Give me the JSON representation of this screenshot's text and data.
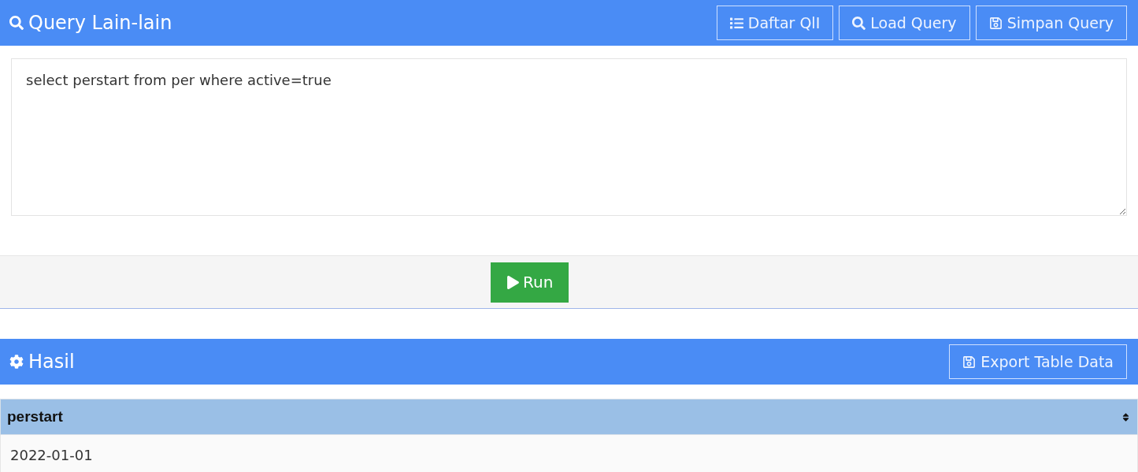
{
  "query_panel": {
    "title": "Query Lain-lain",
    "buttons": [
      {
        "kind": "list",
        "label": "Daftar QlI"
      },
      {
        "kind": "search",
        "label": "Load Query"
      },
      {
        "kind": "save",
        "label": "Simpan Query"
      }
    ],
    "editor": {
      "value": "select perstart from per where active=true"
    },
    "run_button": {
      "label": "Run"
    }
  },
  "result_panel": {
    "title": "Hasil",
    "buttons": [
      {
        "kind": "save",
        "label": "Export Table Data"
      }
    ],
    "table": {
      "columns": [
        "perstart"
      ],
      "rows": [
        [
          "2022-01-01"
        ]
      ]
    }
  }
}
